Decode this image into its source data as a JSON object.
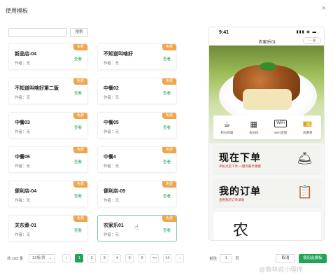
{
  "dialog": {
    "title": "使用模板",
    "close_glyph": "×"
  },
  "search": {
    "placeholder": "",
    "button_label": "搜索"
  },
  "cards": [
    {
      "title": "新品店-04",
      "author": "作者：无",
      "badge": "免费",
      "action": "查看"
    },
    {
      "title": "不知道叫啥好",
      "author": "作者：无",
      "badge": "免费",
      "action": "查看"
    },
    {
      "title": "不知道叫啥好第二版",
      "author": "作者：无",
      "badge": "免费",
      "action": "查看"
    },
    {
      "title": "中餐02",
      "author": "作者：无",
      "badge": "免费",
      "action": "查看"
    },
    {
      "title": "中餐03",
      "author": "作者：无",
      "badge": "免费",
      "action": "查看"
    },
    {
      "title": "中餐05",
      "author": "作者：无",
      "badge": "免费",
      "action": "查看"
    },
    {
      "title": "中餐06",
      "author": "作者：无",
      "badge": "免费",
      "action": "查看"
    },
    {
      "title": "中餐4",
      "author": "作者：无",
      "badge": "免费",
      "action": "查看"
    },
    {
      "title": "便利店-04",
      "author": "作者：无",
      "badge": "免费",
      "action": "查看"
    },
    {
      "title": "便利店-05",
      "author": "作者：无",
      "badge": "免费",
      "action": "查看"
    },
    {
      "title": "关东煮-01",
      "author": "作者：无",
      "badge": "免费",
      "action": "查看"
    },
    {
      "title": "农家乐01",
      "author": "作者：无",
      "badge": "免费",
      "action": "查看"
    }
  ],
  "preview": {
    "time": "9:41",
    "signal": "▮▮▮ ◉ ▬",
    "page_title": "农家乐01",
    "capsule": "··· ◎",
    "icons": [
      {
        "glyph": "☕",
        "label": "积分商城",
        "icon": "teapot-icon"
      },
      {
        "glyph": "▦",
        "label": "会员码",
        "icon": "qrcode-icon"
      },
      {
        "glyph": "WiFi",
        "label": "WIFI连接",
        "icon": "wifi-icon"
      },
      {
        "glyph": "🎫",
        "label": "优惠券",
        "icon": "ticket-icon"
      }
    ],
    "banners": [
      {
        "title": "现在下单",
        "subtitle": "手机点菜下单 一键点餐享便捷",
        "icon": "cloche-icon",
        "glyph": "🛎"
      },
      {
        "title": "我的订单",
        "subtitle": "查看我的订单详情",
        "icon": "clipboard-icon",
        "glyph": "📋"
      }
    ],
    "bottom_glyph": "农"
  },
  "pagination": {
    "total": "共 162 条",
    "page_size": "12条/页",
    "prev": "‹",
    "pages": [
      "1",
      "2",
      "3",
      "4",
      "5",
      "6",
      "•••",
      "14"
    ],
    "next": "›",
    "current_page": "1",
    "goto_label": "前往",
    "goto_value": "1",
    "goto_unit": "页"
  },
  "footer": {
    "cancel_label": "取消",
    "use_label": "使用此模板"
  },
  "watermark": "@简林说小程序",
  "colors": {
    "accent": "#22a35a",
    "badge": "#f0a44c"
  }
}
